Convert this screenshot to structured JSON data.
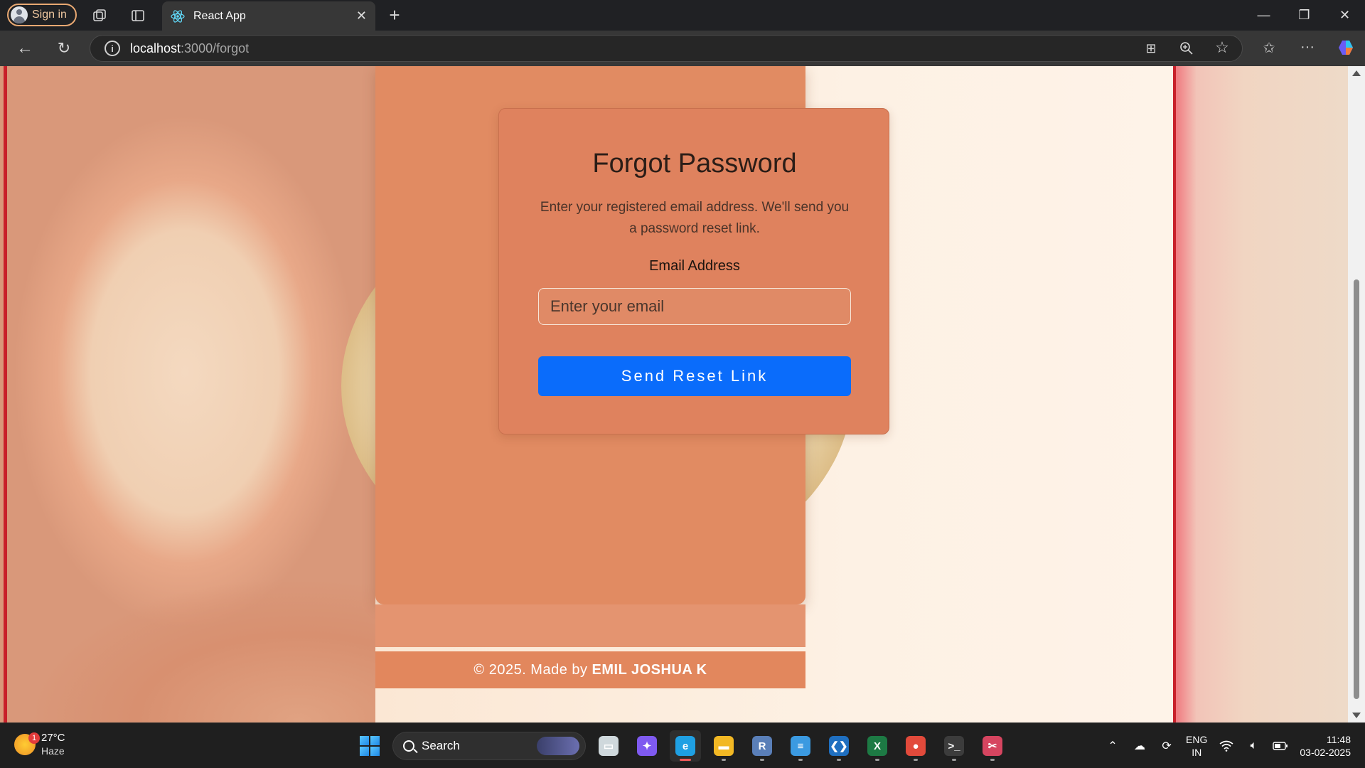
{
  "browser": {
    "signin_label": "Sign in",
    "tab_title": "React App",
    "url_host": "localhost",
    "url_path": ":3000/forgot"
  },
  "page": {
    "title": "Forgot Password",
    "description": "Enter your registered email address. We'll send you a password reset link.",
    "email_label": "Email Address",
    "email_placeholder": "Enter your email",
    "email_value": "",
    "submit_label": "Send Reset Link",
    "footer_prefix": "© 2025. Made by",
    "footer_author": "EMIL JOSHUA K",
    "colors": {
      "card_bg": "#df825e",
      "button_bg": "#0a6cfb",
      "footer_bg": "#e2875d"
    }
  },
  "taskbar": {
    "weather_temp": "27°C",
    "weather_condition": "Haze",
    "weather_badge": "1",
    "search_label": "Search",
    "apps": [
      {
        "name": "task-view-icon",
        "glyph": "▭",
        "color": "#cfd8dc"
      },
      {
        "name": "copilot-icon",
        "glyph": "✦",
        "color": "#7f5af0"
      },
      {
        "name": "edge-icon",
        "glyph": "e",
        "color": "#1fa0e3"
      },
      {
        "name": "file-explorer-icon",
        "glyph": "▬",
        "color": "#f2b824"
      },
      {
        "name": "r-app-icon",
        "glyph": "R",
        "color": "#5a7fb8"
      },
      {
        "name": "notepad-icon",
        "glyph": "≡",
        "color": "#3b9ae1"
      },
      {
        "name": "vscode-icon",
        "glyph": "❮❯",
        "color": "#1f6fc0"
      },
      {
        "name": "excel-icon",
        "glyph": "X",
        "color": "#1d7a44"
      },
      {
        "name": "chrome-icon",
        "glyph": "●",
        "color": "#e24a3b"
      },
      {
        "name": "terminal-icon",
        "glyph": ">_",
        "color": "#3c3c3c"
      },
      {
        "name": "snipping-tool-icon",
        "glyph": "✂",
        "color": "#d64560"
      }
    ],
    "lang_line1": "ENG",
    "lang_line2": "IN",
    "time": "11:48",
    "date": "03-02-2025"
  }
}
